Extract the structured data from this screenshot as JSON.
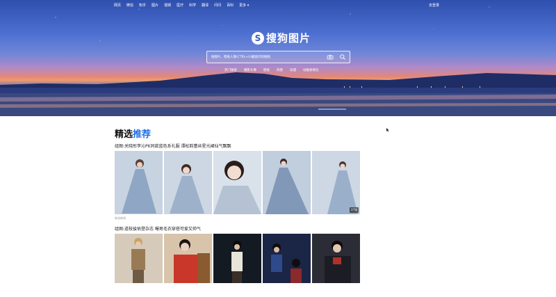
{
  "nav": {
    "items": [
      "网页",
      "微信",
      "知乎",
      "图片",
      "视频",
      "医疗",
      "科学",
      "翻译",
      "问问",
      "百科",
      "更多"
    ],
    "login": "去登录"
  },
  "logo": {
    "text": "搜狗图片"
  },
  "search": {
    "placeholder": "搜图片、壁纸人像(CTRL+V)截图识别搜图"
  },
  "quick_links": [
    "热门搜索",
    "摄影头像",
    "壁纸",
    "风景",
    "动漫",
    "动图表情包"
  ],
  "section": {
    "title_prefix": "精选",
    "title_accent": "推荐"
  },
  "albums": [
    {
      "caption": "组图:关晓彤李沁PK同款蓝色系礼服 谭松韵蕾丝星光裙仙气飘飘",
      "source": "新浪新闻",
      "count": "37张",
      "colors": [
        "#b9c9dc",
        "#c2cfdf",
        "#c9d4e2",
        "#b3c3d6",
        "#cbd6e2"
      ]
    },
    {
      "caption": "组图:道枝骏佑登杂志 曝男毛衣穿搭可爱又帅气",
      "source": "",
      "count": "",
      "colors": [
        "#c9bfae",
        "#c3402e",
        "#1e2530",
        "#1d2848",
        "#2a2a35"
      ]
    }
  ]
}
